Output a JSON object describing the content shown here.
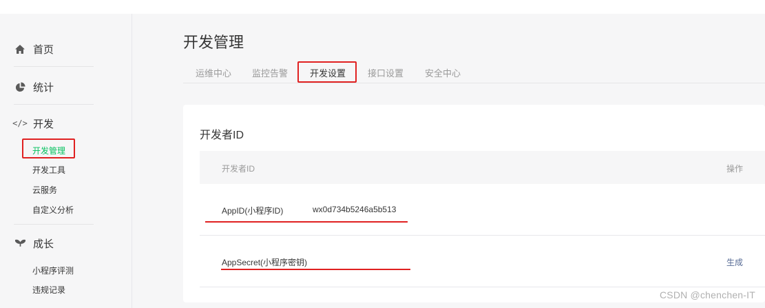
{
  "sidebar": {
    "home": {
      "label": "首页"
    },
    "stats": {
      "label": "统计"
    },
    "dev": {
      "label": "开发",
      "icon": "</>",
      "items": [
        "开发管理",
        "开发工具",
        "云服务",
        "自定义分析"
      ]
    },
    "growth": {
      "label": "成长",
      "items": [
        "小程序评测",
        "违规记录"
      ]
    }
  },
  "page": {
    "title": "开发管理",
    "tabs": [
      "运维中心",
      "监控告警",
      "开发设置",
      "接口设置",
      "安全中心"
    ]
  },
  "card": {
    "title": "开发者ID",
    "columns": {
      "id": "开发者ID",
      "action": "操作"
    },
    "rows": [
      {
        "label": "AppID(小程序ID)",
        "value": "wx0d734b5246a5b513",
        "action": ""
      },
      {
        "label": "AppSecret(小程序密钥)",
        "value": "",
        "action": "生成"
      }
    ]
  },
  "watermark": "CSDN @chenchen-IT",
  "colors": {
    "accent_green": "#07c160",
    "highlight_red": "#e02020",
    "link_blue": "#576b95"
  }
}
